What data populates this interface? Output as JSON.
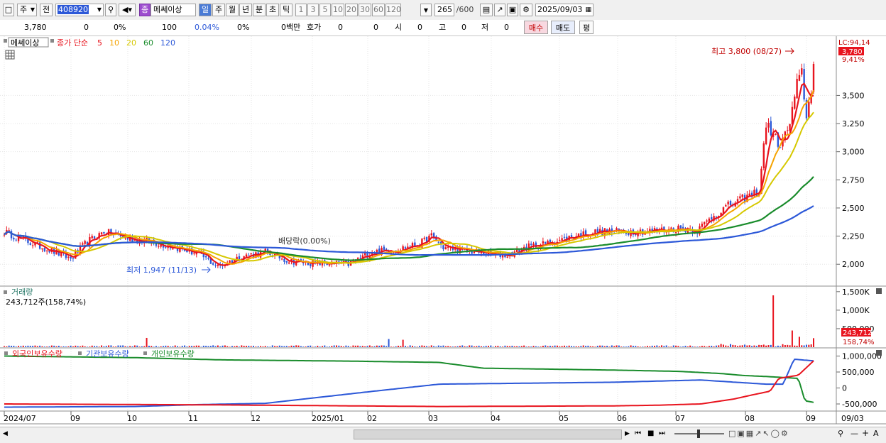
{
  "toolbar": {
    "market": "주",
    "prev_label": "전",
    "code": "408920",
    "stock_badge": "종",
    "stock_name": "메쎄이상",
    "periods": [
      "일",
      "주",
      "월",
      "년",
      "분",
      "초",
      "틱"
    ],
    "active_period": "일",
    "intervals": [
      "1",
      "3",
      "5",
      "10",
      "20",
      "30",
      "60",
      "120"
    ],
    "count": "265",
    "total": "/600",
    "date": "2025/09/03"
  },
  "quote": {
    "price": "3,780",
    "change": "0",
    "change_pct": "0%",
    "volume": "100",
    "vol_ratio": "0.04%",
    "vol_change": "0%",
    "amount": "0백만",
    "bid_label": "호가",
    "bid1": "0",
    "bid2": "0",
    "open_label": "시",
    "open": "0",
    "high_label": "고",
    "high": "0",
    "low_label": "저",
    "low": "0",
    "buy_label": "매수",
    "sell_label": "매도",
    "avg_label": "평"
  },
  "price_panel": {
    "name": "메쎄이상",
    "ma_label": "종가 단순",
    "ma_periods": [
      "5",
      "10",
      "20",
      "60",
      "120"
    ],
    "ma_colors": [
      "#e8141e",
      "#f5a300",
      "#d6c800",
      "#1a8c2c",
      "#2c58d8"
    ],
    "lc_label": "LC:94,14",
    "last_price": "3,780",
    "last_pct": "9,41%",
    "high_note": "최고 3,800 (08/27)",
    "low_note": "최저 1,947 (11/13)",
    "dividend_note": "배당락(0.00%)",
    "yticks": [
      "3,500",
      "3,250",
      "3,000",
      "2,750",
      "2,500",
      "2,250",
      "2,000"
    ]
  },
  "volume_panel": {
    "title": "거래량",
    "value": "243,712주(158,74%)",
    "yticks": [
      "1,500K",
      "1,000K",
      "500,000"
    ],
    "last": "243,712",
    "last_pct": "158,74%"
  },
  "holdings_panel": {
    "titles": [
      "외국인보유수량",
      "기관보유수량",
      "개인보유수량"
    ],
    "colors": [
      "#e8141e",
      "#2c58d8",
      "#1a8c2c"
    ],
    "yticks": [
      "1,000,000",
      "500,000",
      "0",
      "-500,000"
    ]
  },
  "x_axis": {
    "labels": [
      "2024/07",
      "09",
      "10",
      "11",
      "12",
      "2025/01",
      "02",
      "03",
      "04",
      "05",
      "06",
      "07",
      "08",
      "09",
      "09/03"
    ]
  },
  "chart_data": {
    "type": "candlestick",
    "price_ylim": [
      1850,
      3900
    ],
    "price_anchors": [
      [
        0,
        2290
      ],
      [
        10,
        2200
      ],
      [
        20,
        2120
      ],
      [
        28,
        2050
      ],
      [
        35,
        2200
      ],
      [
        42,
        2290
      ],
      [
        52,
        2230
      ],
      [
        62,
        2200
      ],
      [
        72,
        2150
      ],
      [
        82,
        2090
      ],
      [
        90,
        1980
      ],
      [
        100,
        2070
      ],
      [
        110,
        2110
      ],
      [
        120,
        2030
      ],
      [
        130,
        2010
      ],
      [
        145,
        2000
      ],
      [
        155,
        2110
      ],
      [
        165,
        2130
      ],
      [
        175,
        2180
      ],
      [
        180,
        2250
      ],
      [
        185,
        2150
      ],
      [
        195,
        2120
      ],
      [
        205,
        2090
      ],
      [
        212,
        2080
      ],
      [
        220,
        2150
      ],
      [
        230,
        2190
      ],
      [
        240,
        2250
      ],
      [
        250,
        2290
      ],
      [
        262,
        2290
      ],
      [
        275,
        2300
      ],
      [
        285,
        2320
      ],
      [
        292,
        2300
      ],
      [
        298,
        2420
      ],
      [
        305,
        2520
      ],
      [
        311,
        2580
      ],
      [
        318,
        2650
      ],
      [
        321,
        3250
      ],
      [
        327,
        3050
      ],
      [
        331,
        3250
      ],
      [
        334,
        3600
      ],
      [
        336,
        3700
      ],
      [
        338,
        3300
      ],
      [
        340,
        3550
      ],
      [
        341,
        3780
      ]
    ],
    "volume_ylim": [
      0,
      1650000
    ],
    "volume_spikes": {
      "60": 250,
      "162": 220,
      "168": 200,
      "324": 1400,
      "332": 450,
      "335": 280,
      "341": 243
    }
  }
}
